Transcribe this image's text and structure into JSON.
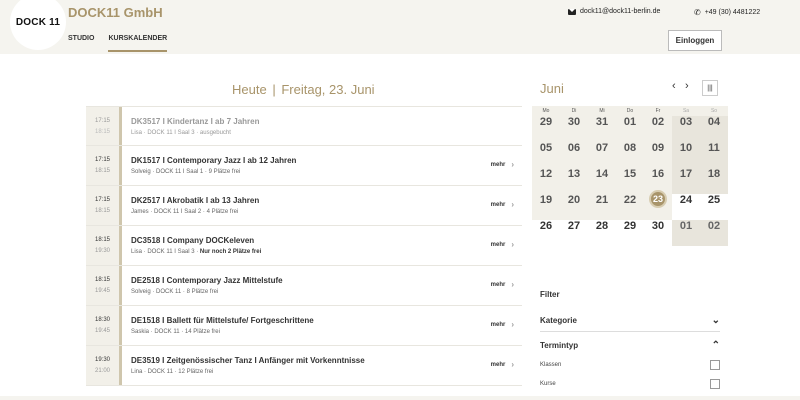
{
  "header": {
    "logo_text": "DOCK 11",
    "company": "DOCK11 GmbH",
    "nav": [
      "STUDIO",
      "KURSKALENDER"
    ],
    "email": "dock11@dock11-berlin.de",
    "phone": "+49 (30) 4481222",
    "login_label": "Einloggen"
  },
  "day": {
    "today_label": "Heute",
    "separator": "|",
    "date_label": "Freitag, 23. Juni"
  },
  "courses": [
    {
      "start": "17:15",
      "end": "18:15",
      "title": "DK3517 I Kindertanz I ab 7 Jahren",
      "meta": "Lisa · DOCK 11 I Saal 3 · ausgebucht",
      "strong": "",
      "more": ""
    },
    {
      "start": "17:15",
      "end": "18:15",
      "title": "DK1517 I Contemporary Jazz I ab 12 Jahren",
      "meta": "Solveig · DOCK 11 I Saal 1 · 9 Plätze frei",
      "strong": "",
      "more": "mehr"
    },
    {
      "start": "17:15",
      "end": "18:15",
      "title": "DK2517 I Akrobatik I ab 13 Jahren",
      "meta": "James · DOCK 11 I Saal 2 · 4 Plätze frei",
      "strong": "",
      "more": "mehr"
    },
    {
      "start": "18:15",
      "end": "19:30",
      "title": "DC3518 I Company DOCKeleven",
      "meta": "Lisa · DOCK 11 I Saal 3 · ",
      "strong": "Nur noch 2 Plätze frei",
      "more": "mehr"
    },
    {
      "start": "18:15",
      "end": "19:45",
      "title": "DE2518 I Contemporary Jazz Mittelstufe",
      "meta": "Solveig · DOCK 11 · 8 Plätze frei",
      "strong": "",
      "more": "mehr"
    },
    {
      "start": "18:30",
      "end": "19:45",
      "title": "DE1518 I Ballett für Mittelstufe/ Fortgeschrittene",
      "meta": "Saskia · DOCK 11 · 14 Plätze frei",
      "strong": "",
      "more": "mehr"
    },
    {
      "start": "19:30",
      "end": "21:00",
      "title": "DE3519 I Zeitgenössischer Tanz I Anfänger mit Vorkenntnisse",
      "meta": "Lina · DOCK 11 · 12 Plätze frei",
      "strong": "",
      "more": "mehr"
    }
  ],
  "calendar": {
    "month": "Juni",
    "prev_icon": "chevron-left-icon",
    "next_icon": "chevron-right-icon",
    "view_icon": "grid-view-icon",
    "weekdays": [
      "Mo",
      "Di",
      "Mi",
      "Do",
      "Fr",
      "Sa",
      "So"
    ],
    "today": "23",
    "weeks": [
      [
        "29",
        "30",
        "31",
        "01",
        "02",
        "03",
        "04"
      ],
      [
        "05",
        "06",
        "07",
        "08",
        "09",
        "10",
        "11"
      ],
      [
        "12",
        "13",
        "14",
        "15",
        "16",
        "17",
        "18"
      ],
      [
        "19",
        "20",
        "21",
        "22",
        "23",
        "24",
        "25"
      ],
      [
        "26",
        "27",
        "28",
        "29",
        "30",
        "01",
        "02"
      ]
    ]
  },
  "filter": {
    "title": "Filter",
    "category_label": "Kategorie",
    "type_label": "Termintyp",
    "options": [
      "Klassen",
      "Kurse"
    ]
  },
  "colors": {
    "accent": "#a8946a",
    "header_bg": "#f5f4ef",
    "calendar_bg": "#f2f0e9"
  }
}
